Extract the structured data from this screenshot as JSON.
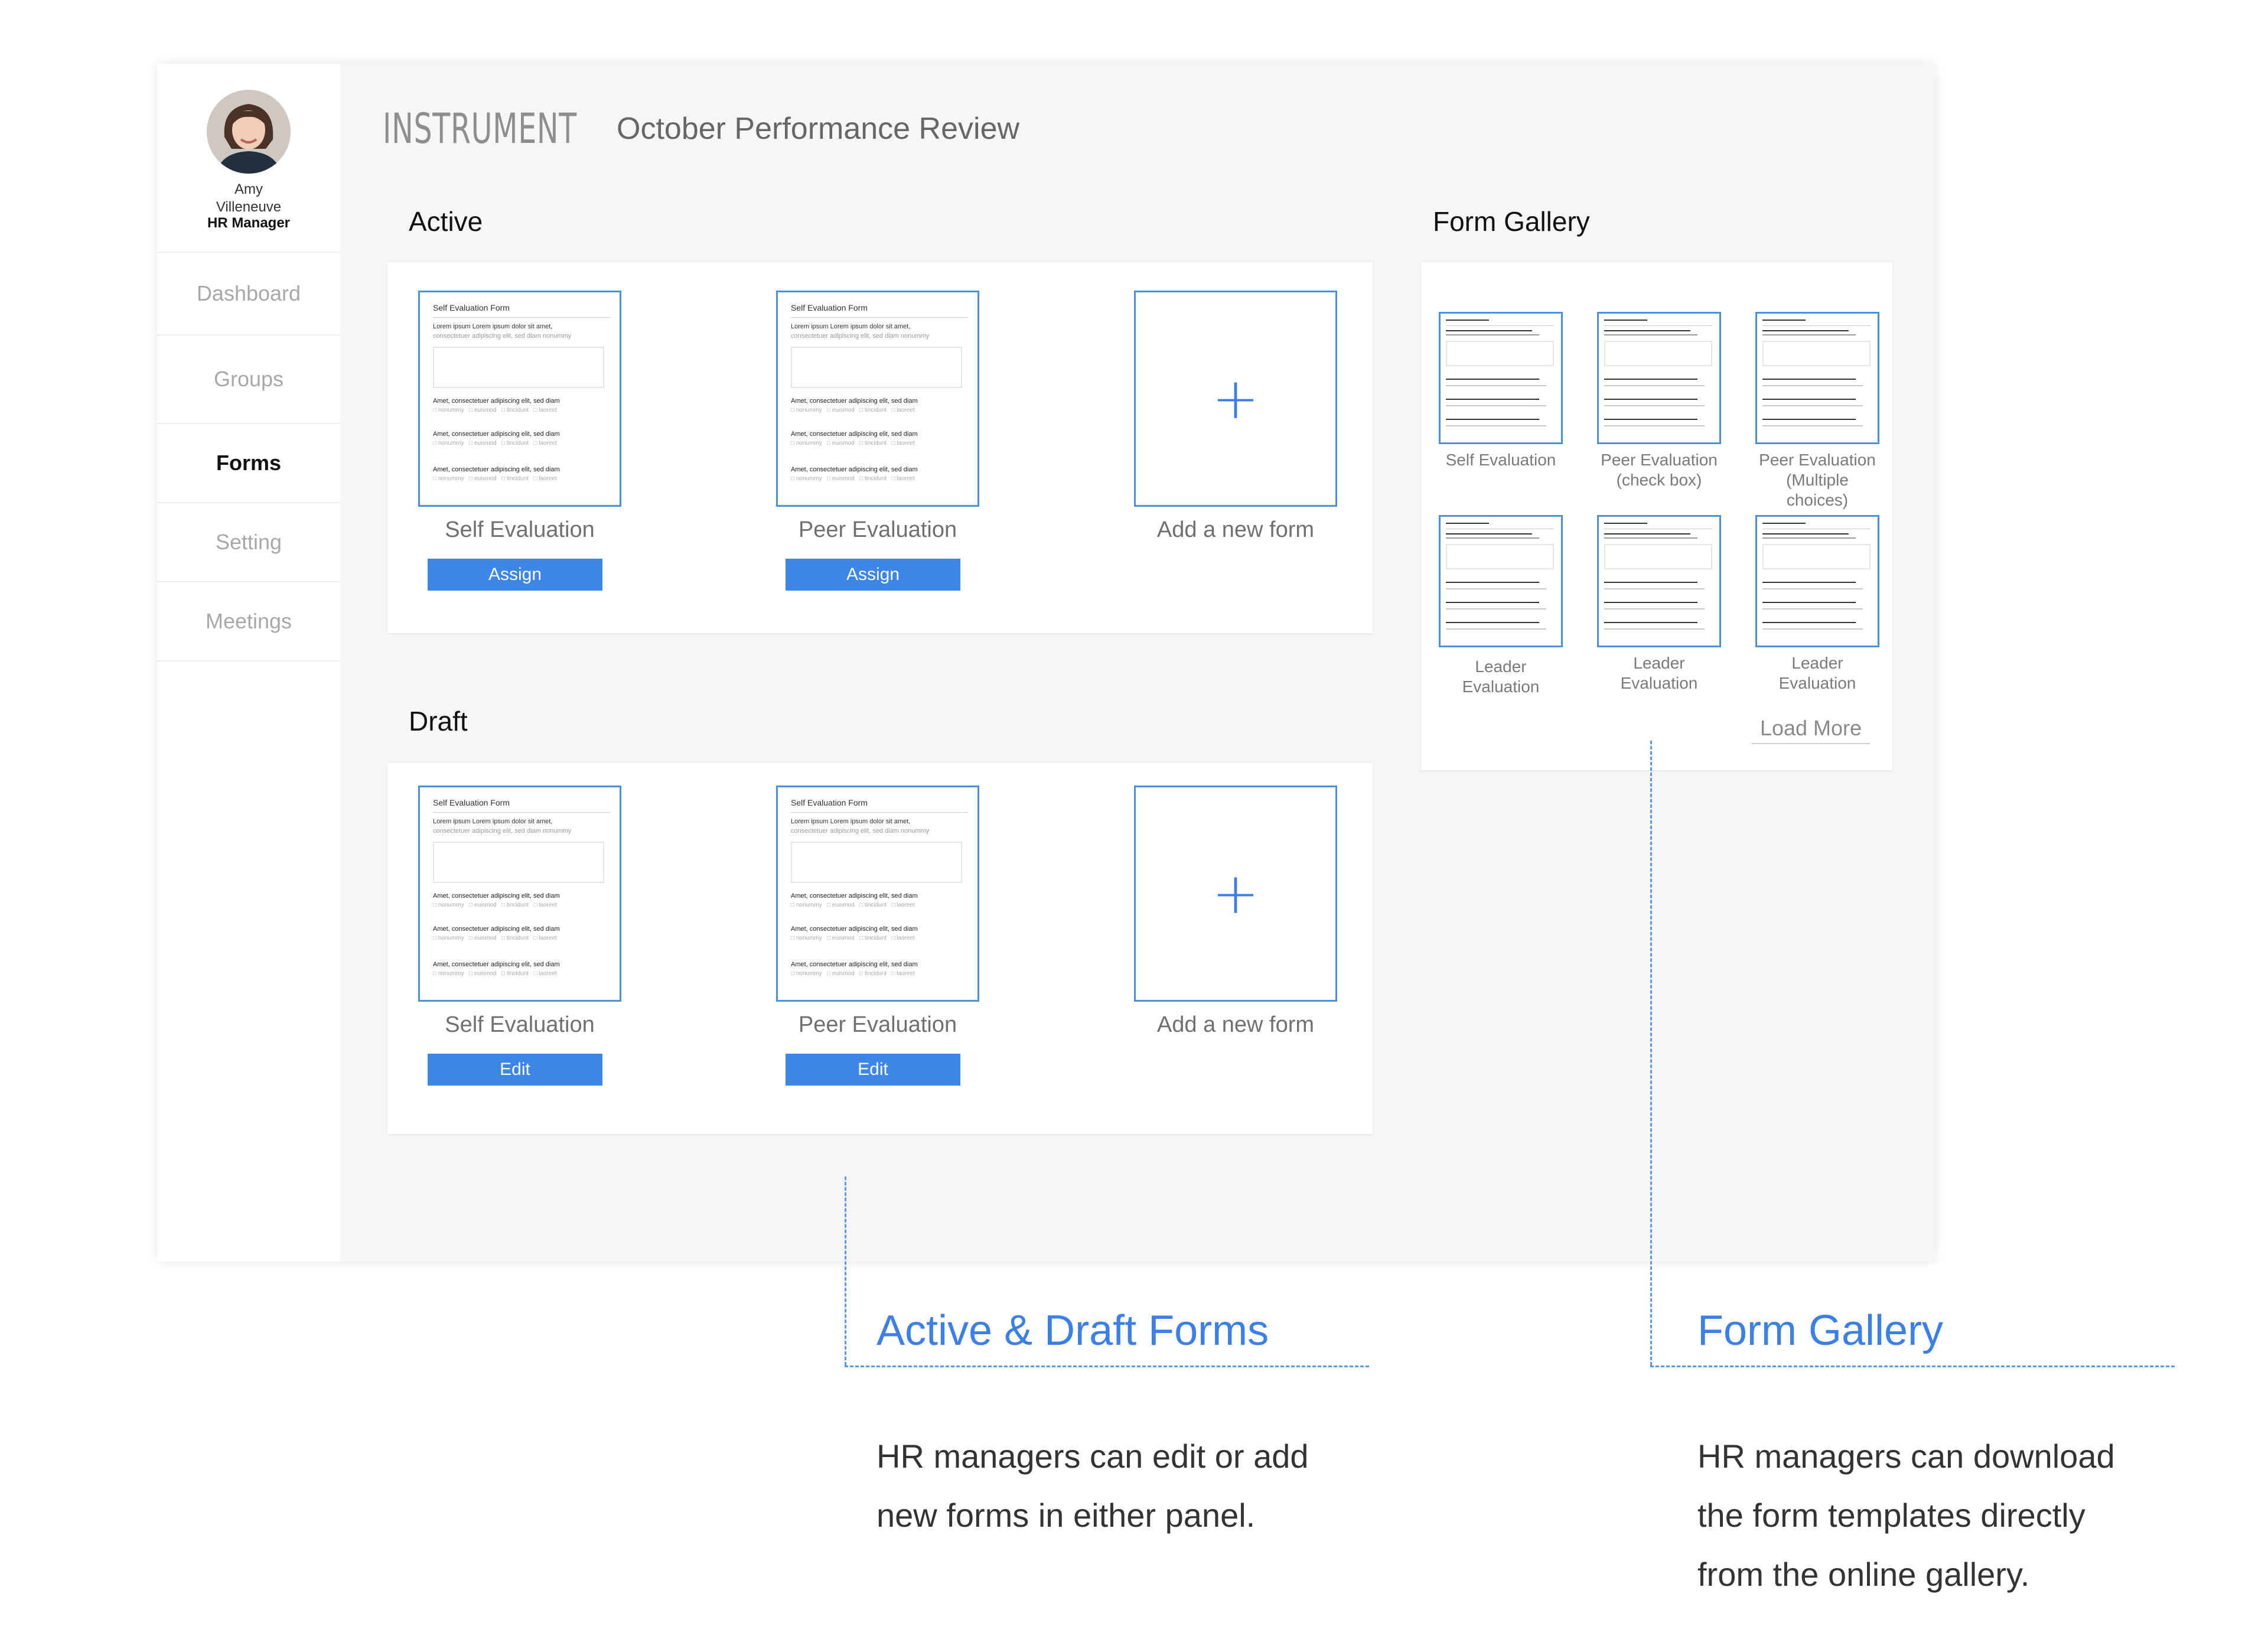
{
  "user": {
    "name_line1": "Amy",
    "name_line2": "Villeneuve",
    "role": "HR Manager"
  },
  "nav": [
    {
      "label": "Dashboard",
      "active": false
    },
    {
      "label": "Groups",
      "active": false
    },
    {
      "label": "Forms",
      "active": true
    },
    {
      "label": "Setting",
      "active": false
    },
    {
      "label": "Meetings",
      "active": false
    }
  ],
  "header": {
    "brand": "INSTRUMENT",
    "title": "October Performance Review"
  },
  "form_preview": {
    "title": "Self Evaluation Form",
    "line1": "Lorem ipsum Lorem ipsum dolor sit amet,",
    "line2": "consectetuer adipiscing elit, sed diam nonummy",
    "question": "Amet, consectetuer adipiscing elit, sed diam",
    "options": "nonummy   euismod   tincidunt   laoreet"
  },
  "active": {
    "heading": "Active",
    "cards": [
      {
        "label": "Self Evaluation",
        "button": "Assign"
      },
      {
        "label": "Peer Evaluation",
        "button": "Assign"
      },
      {
        "label": "Add a new form"
      }
    ]
  },
  "draft": {
    "heading": "Draft",
    "cards": [
      {
        "label": "Self Evaluation",
        "button": "Edit"
      },
      {
        "label": "Peer Evaluation",
        "button": "Edit"
      },
      {
        "label": "Add a new form"
      }
    ]
  },
  "gallery": {
    "heading": "Form Gallery",
    "items": [
      {
        "line1": "Self Evaluation",
        "line2": ""
      },
      {
        "line1": "Peer Evaluation",
        "line2": "(check box)"
      },
      {
        "line1": "Peer Evaluation",
        "line2": "(Multiple choices)"
      },
      {
        "line1": "Leader",
        "line2": "Evaluation"
      },
      {
        "line1": "Leader",
        "line2": "Evaluation"
      },
      {
        "line1": "Leader",
        "line2": "Evaluation"
      }
    ],
    "load_more": "Load More"
  },
  "annotations": [
    {
      "title": "Active & Draft Forms",
      "body_line1": "HR managers can edit or add",
      "body_line2": "new forms in either panel.",
      "body_line3": ""
    },
    {
      "title": "Form Gallery",
      "body_line1": "HR managers can download",
      "body_line2": "the form templates directly",
      "body_line3": "from the online gallery."
    }
  ],
  "colors": {
    "accent": "#3d86e8",
    "annotation": "#3b80ea",
    "app_bg": "#f6f6f7"
  }
}
